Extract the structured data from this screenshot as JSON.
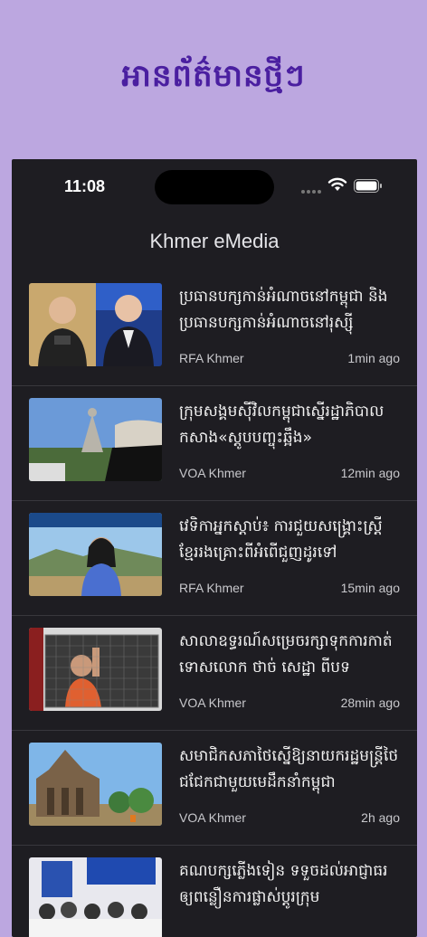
{
  "promo": {
    "title": "អានព័ត៌មានថ្មីៗ"
  },
  "status_bar": {
    "time": "11:08"
  },
  "app": {
    "title": "Khmer eMedia"
  },
  "colors": {
    "background": "#bca7e0",
    "title": "#4a1fa0",
    "screen": "#1e1d22"
  },
  "news": [
    {
      "headline": "ប្រធានបក្សកាន់អំណាចនៅកម្ពុជា និងប្រធានបក្សកាន់អំណាចនៅរុស្ស៊ី",
      "source": "RFA Khmer",
      "time": "1min ago"
    },
    {
      "headline": "ក្រុមសង្គមស៊ីវិលកម្ពុជាស្នើរដ្ឋាភិបាលកសាង«ស្តូបបញ្ចុះឆ្អឹង»",
      "source": "VOA Khmer",
      "time": "12min ago"
    },
    {
      "headline": "វេទិកាអ្នកស្តាប់៖ ការជួយសង្គ្រោះស្ត្រីខ្មែររងគ្រោះពីអំពើជួញដូរទៅ",
      "source": "RFA Khmer",
      "time": "15min ago"
    },
    {
      "headline": "សាលាឧទ្ធរណ៍សម្រេចរក្សាទុកការកាត់ទោសលោក ថាច់ សេដ្ឋា ពីបទ",
      "source": "VOA Khmer",
      "time": "28min ago"
    },
    {
      "headline": "សមាជិកសភាថៃស្នើឱ្យនាយករដ្ឋមន្ត្រីថៃជជែកជាមួយមេដឹកនាំកម្ពុជា",
      "source": "VOA Khmer",
      "time": "2h ago"
    },
    {
      "headline": "គណបក្សភ្លើងទៀន ទទួចដល់អាជ្ញាធរឲ្យពន្លឿនការផ្លាស់ប្តូរក្រុម",
      "source": "",
      "time": ""
    }
  ]
}
